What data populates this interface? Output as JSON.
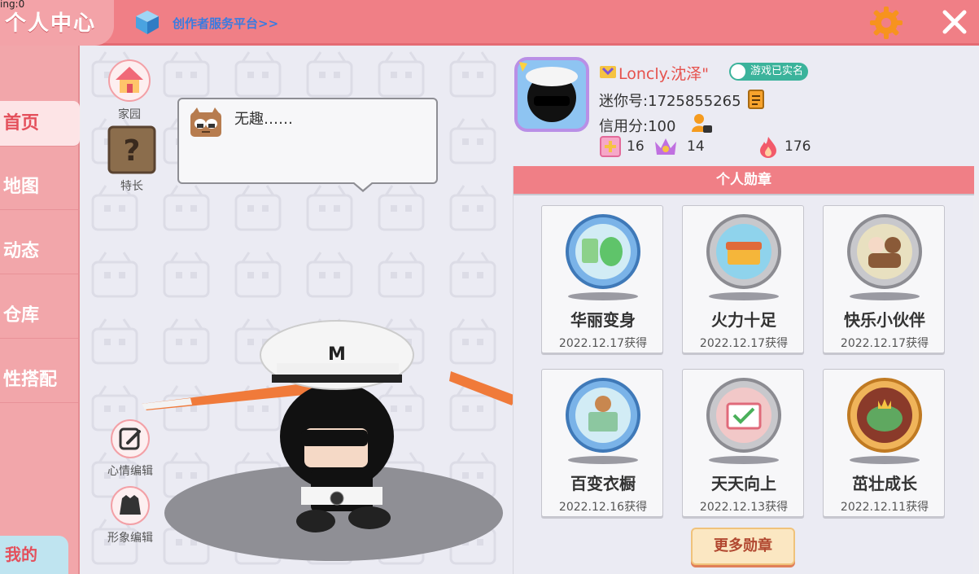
{
  "header": {
    "debug_text": "ing:0",
    "title": "个人中心",
    "creator_link": "创作者服务平台>>"
  },
  "sidebar": {
    "items": [
      {
        "label": "首页",
        "active": true
      },
      {
        "label": "地图",
        "active": false
      },
      {
        "label": "动态",
        "active": false
      },
      {
        "label": "仓库",
        "active": false
      },
      {
        "label": "性搭配",
        "active": false
      }
    ],
    "mine_label": "我的"
  },
  "center": {
    "home_label": "家园",
    "talent_label": "特长",
    "mood_text": "无趣……",
    "mood_edit_label": "心情编辑",
    "look_edit_label": "形象编辑"
  },
  "profile": {
    "nickname": "Loncly.沈泽\"",
    "realname_badge": "游戏已实名",
    "mini_id": "迷你号:1725855265",
    "credit": "信用分:100",
    "stats": [
      "16",
      "14",
      "176"
    ]
  },
  "medals": {
    "header": "个人勋章",
    "items": [
      {
        "name": "华丽变身",
        "date": "2022.12.17获得"
      },
      {
        "name": "火力十足",
        "date": "2022.12.17获得"
      },
      {
        "name": "快乐小伙伴",
        "date": "2022.12.17获得"
      },
      {
        "name": "百变衣橱",
        "date": "2022.12.16获得"
      },
      {
        "name": "天天向上",
        "date": "2022.12.13获得"
      },
      {
        "name": "茁壮成长",
        "date": "2022.12.11获得"
      }
    ],
    "more_label": "更多勋章"
  },
  "colors": {
    "header_pink": "#f07f86",
    "sidebar_pink": "#f2a6aa",
    "accent_red": "#e4505c",
    "link_blue": "#3a7be0",
    "realname_green": "#3bb39b"
  },
  "icons": [
    "creator-cube-icon",
    "gear-icon",
    "close-icon",
    "home-icon",
    "mystery-box-icon",
    "mood-emoji-icon",
    "edit-icon",
    "outfit-icon",
    "copy-icon",
    "credit-person-icon",
    "plus-icon",
    "crown-icon",
    "flame-icon"
  ]
}
